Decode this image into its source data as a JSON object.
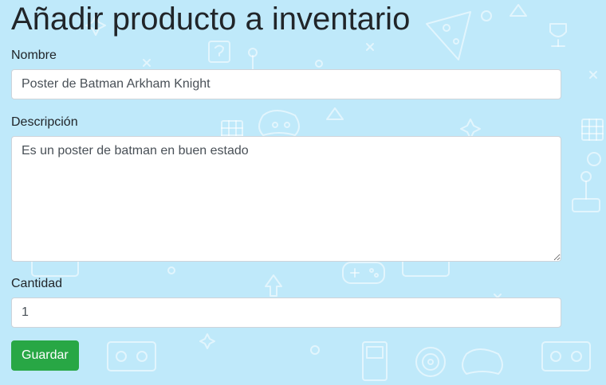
{
  "page": {
    "title": "Añadir producto a inventario"
  },
  "form": {
    "nombre": {
      "label": "Nombre",
      "value": "Poster de Batman Arkham Knight"
    },
    "descripcion": {
      "label": "Descripción",
      "value": "Es un poster de batman en buen estado"
    },
    "cantidad": {
      "label": "Cantidad",
      "value": "1"
    },
    "submit_label": "Guardar"
  },
  "theme": {
    "background": "#bfe9fa",
    "doodle_color": "#ffffff",
    "button_color": "#28a745"
  }
}
